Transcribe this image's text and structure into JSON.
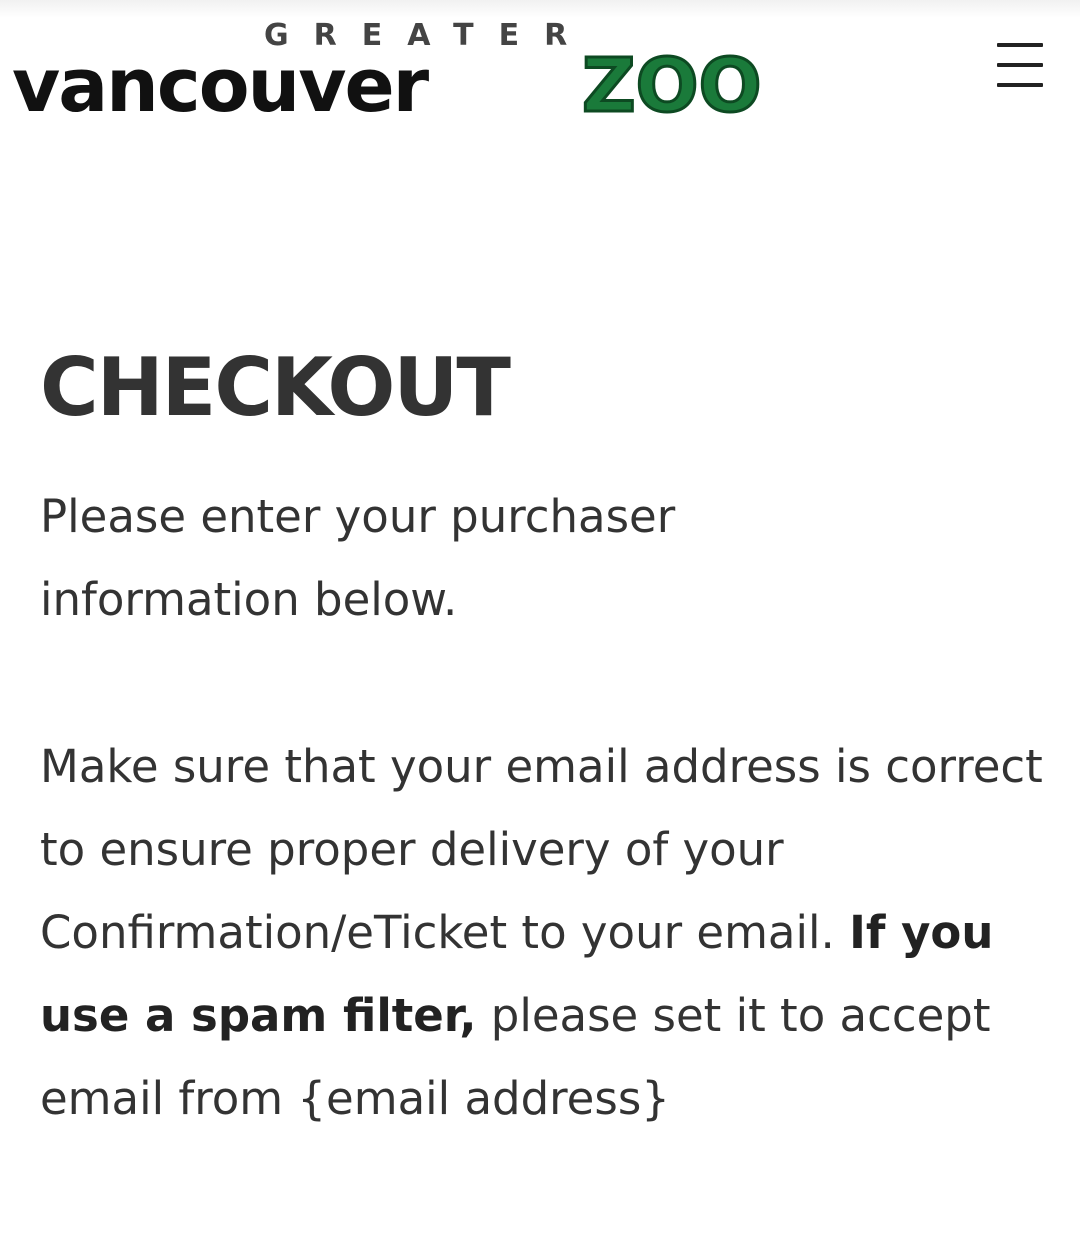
{
  "header": {
    "logo": {
      "top_word": "GREATER",
      "main_word": "vancouver",
      "accent_word": "ZOO",
      "accent_color": "#0d4a22",
      "accent_fill": "#1a7a3a"
    },
    "menu_icon": "hamburger-menu-icon"
  },
  "main": {
    "title": "CHECKOUT",
    "intro_line1": "Please enter your purchaser",
    "intro_line2": "information below.",
    "notice_before": "Make sure that your email address is correct to ensure proper delivery of your Confirmation/eTicket to your email. ",
    "notice_bold": "If you use a spam filter,",
    "notice_after": " please set it to accept email from {email address}"
  }
}
